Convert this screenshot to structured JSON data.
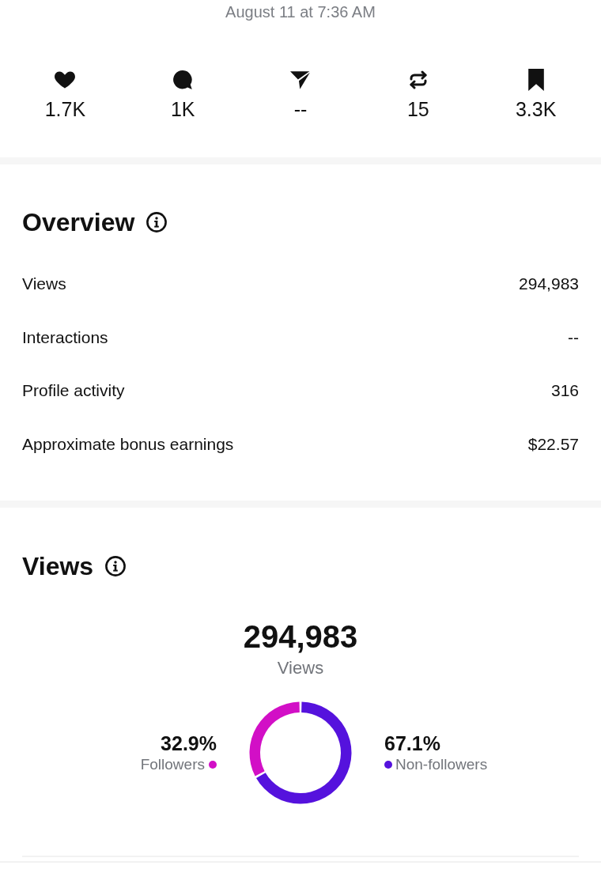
{
  "timestamp": "August 11 at 7:36 AM",
  "stats": [
    {
      "kind": "like",
      "value": "1.7K"
    },
    {
      "kind": "comment",
      "value": "1K"
    },
    {
      "kind": "share",
      "value": "--"
    },
    {
      "kind": "repost",
      "value": "15"
    },
    {
      "kind": "save",
      "value": "3.3K"
    }
  ],
  "overview": {
    "title": "Overview",
    "rows": [
      {
        "label": "Views",
        "value": "294,983"
      },
      {
        "label": "Interactions",
        "value": "--"
      },
      {
        "label": "Profile activity",
        "value": "316"
      },
      {
        "label": "Approximate bonus earnings",
        "value": "$22.57"
      }
    ]
  },
  "views": {
    "title": "Views",
    "total": "294,983",
    "total_label": "Views",
    "legend": [
      {
        "value": "32.9%",
        "color": "#d20fc6"
      },
      {
        "value": "67.1%",
        "color": "#5512dd"
      }
    ],
    "chart_data": {
      "type": "donut",
      "categories": [
        "Followers",
        "Non-followers"
      ],
      "values": [
        32.9,
        67.1
      ]
    }
  }
}
